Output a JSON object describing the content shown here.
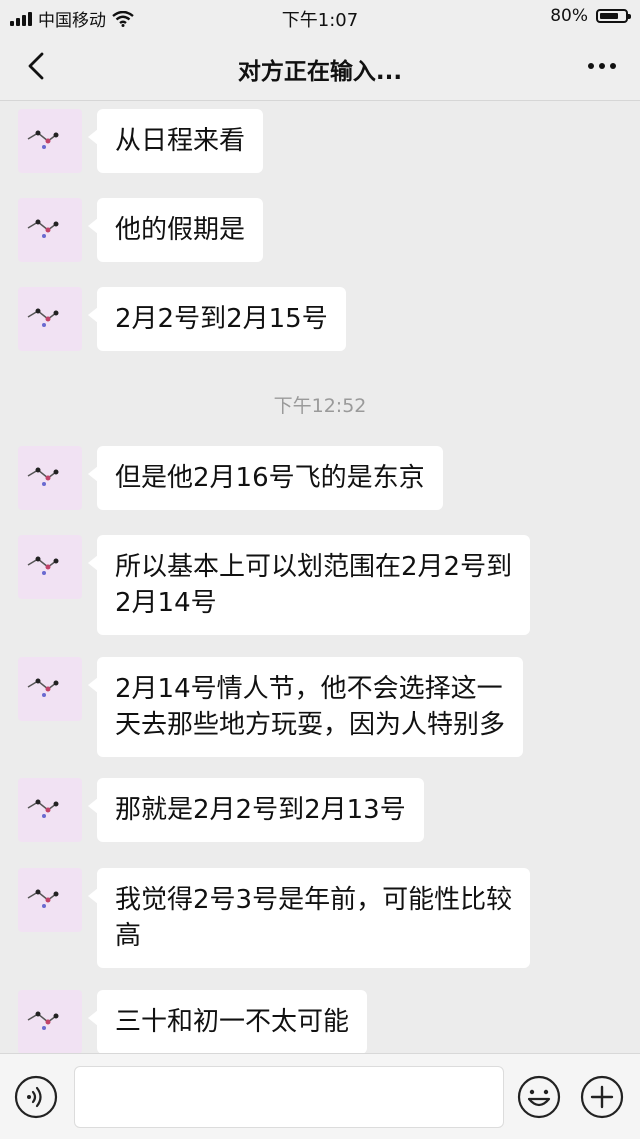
{
  "status_bar": {
    "carrier": "中国移动",
    "time": "下午1:07",
    "battery": "80%",
    "battery_level": 0.8
  },
  "nav": {
    "title": "对方正在输入..."
  },
  "chat": {
    "divider_time": "下午12:52",
    "messages": [
      {
        "text": "从日程来看"
      },
      {
        "text": "他的假期是"
      },
      {
        "text": "2月2号到2月15号"
      },
      {
        "text": "但是他2月16号飞的是东京"
      },
      {
        "line1": "所以基本上可以划范围在2月2号到",
        "line2": "2月14号"
      },
      {
        "line1": "2月14号情人节，他不会选择这一",
        "line2": "天去那些地方玩耍，因为人特别多"
      },
      {
        "text": "那就是2月2号到2月13号"
      },
      {
        "line1": "我觉得2号3号是年前，可能性比较",
        "line2": "高"
      },
      {
        "text": "三十和初一不太可能"
      }
    ]
  },
  "input_bar": {
    "value": "",
    "voice_icon": "voice-icon",
    "emoji_icon": "emoji-icon",
    "plus_icon": "plus-icon"
  },
  "colors": {
    "background": "#ececec",
    "bubble": "#ffffff",
    "avatar_bg": "#f1e2f3"
  }
}
